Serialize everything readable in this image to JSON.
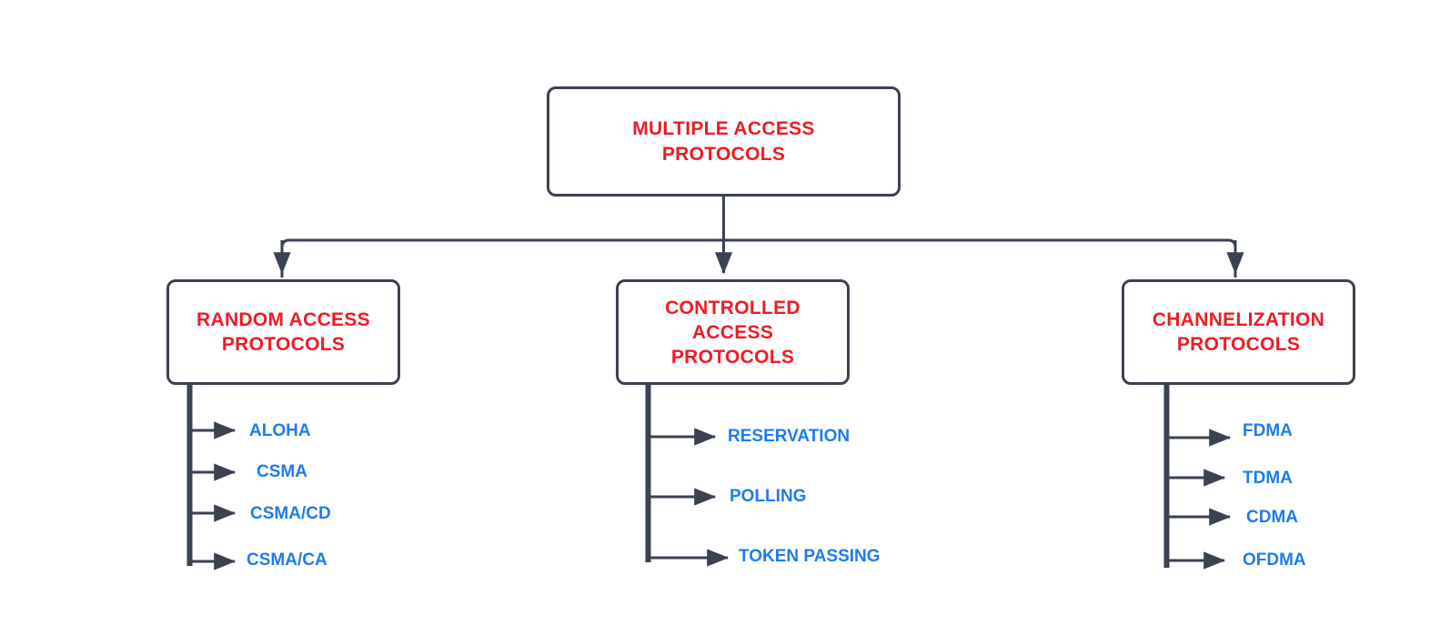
{
  "diagram": {
    "title": "Multiple Access Protocols classification",
    "colors": {
      "box_border": "#3b4252",
      "box_fill": "#ffffff",
      "node_text": "#ee1b24",
      "leaf_text": "#1f7bf0",
      "connector": "#3b4252",
      "background": "#ffffff"
    },
    "root": {
      "label": "MULTIPLE ACCESS\nPROTOCOLS"
    },
    "branches": [
      {
        "id": "random-access",
        "label": "RANDOM ACCESS\nPROTOCOLS",
        "leaves": [
          {
            "label": "ALOHA"
          },
          {
            "label": "CSMA"
          },
          {
            "label": "CSMA/CD"
          },
          {
            "label": "CSMA/CA"
          }
        ]
      },
      {
        "id": "controlled-access",
        "label": "CONTROLLED\nACCESS\nPROTOCOLS",
        "leaves": [
          {
            "label": "RESERVATION"
          },
          {
            "label": "POLLING"
          },
          {
            "label": "TOKEN PASSING"
          }
        ]
      },
      {
        "id": "channelization",
        "label": "CHANNELIZATION\nPROTOCOLS",
        "leaves": [
          {
            "label": "FDMA"
          },
          {
            "label": "TDMA"
          },
          {
            "label": "CDMA"
          },
          {
            "label": "OFDMA"
          }
        ]
      }
    ]
  }
}
